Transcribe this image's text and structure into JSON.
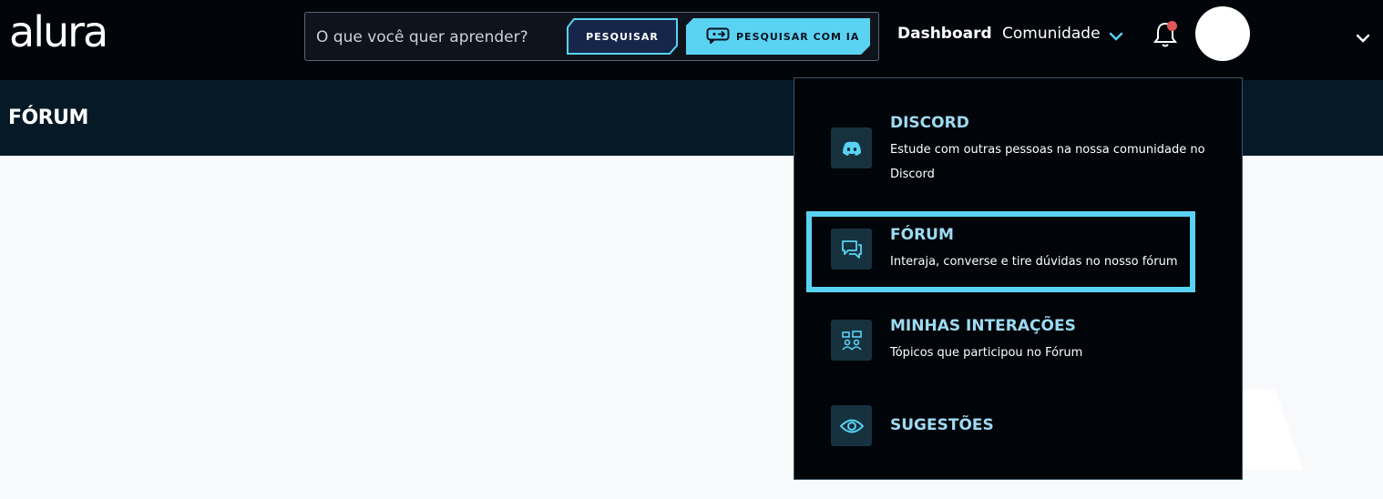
{
  "header": {
    "logo": "alura",
    "search": {
      "placeholder": "O que você quer aprender?",
      "button_label": "PESQUISAR",
      "ai_button_label": "PESQUISAR COM IA"
    },
    "nav": {
      "dashboard": "Dashboard",
      "comunidade": "Comunidade"
    },
    "notification_dot_color": "#e0565b"
  },
  "page": {
    "title": "FÓRUM"
  },
  "dropdown": {
    "items": [
      {
        "title": "DISCORD",
        "description": "Estude com outras pessoas na nossa comunidade no Discord",
        "icon": "discord-icon"
      },
      {
        "title": "FÓRUM",
        "description": "Interaja, converse e tire dúvidas no nosso fórum",
        "icon": "chat-bubbles-icon",
        "highlighted": true
      },
      {
        "title": "MINHAS INTERAÇÕES",
        "description": "Tópicos que participou no Fórum",
        "icon": "interactions-icon"
      },
      {
        "title": "SUGESTÕES",
        "description": "",
        "icon": "eye-icon"
      }
    ]
  },
  "colors": {
    "accent": "#5ad3f3",
    "topbar": "#010409",
    "subheader": "#051a26",
    "icon_tile": "#16323f",
    "menu_title": "#9ddbf2"
  }
}
